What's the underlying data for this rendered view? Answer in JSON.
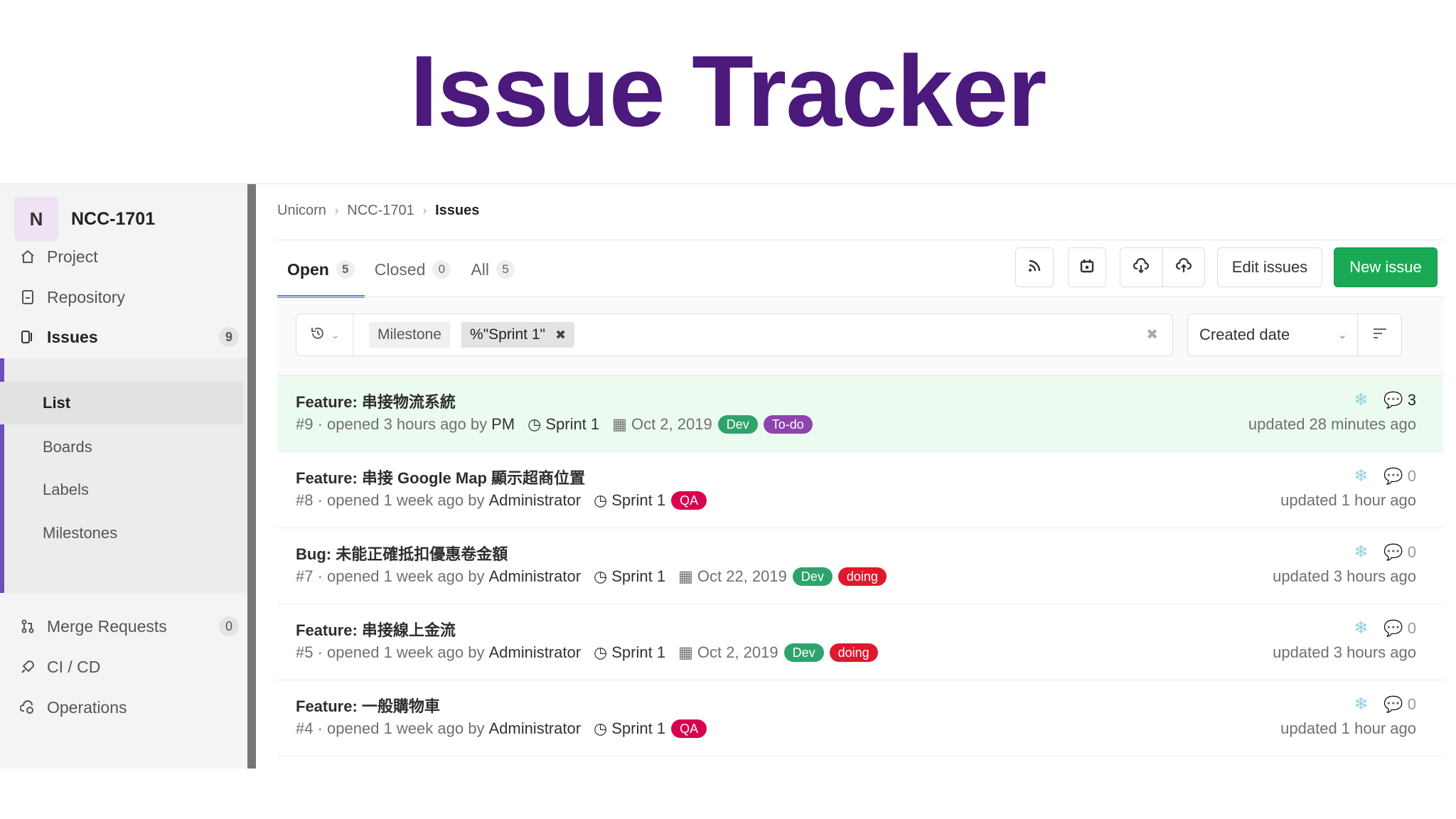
{
  "slide_title": "Issue Tracker",
  "project": {
    "avatar_letter": "N",
    "name": "NCC-1701"
  },
  "sidebar": {
    "items": [
      {
        "label": "Project",
        "icon": "home-icon"
      },
      {
        "label": "Repository",
        "icon": "document-icon"
      },
      {
        "label": "Issues",
        "icon": "issues-icon",
        "count": "9"
      },
      {
        "label": "Merge Requests",
        "icon": "merge-request-icon",
        "count": "0"
      },
      {
        "label": "CI / CD",
        "icon": "rocket-icon"
      },
      {
        "label": "Operations",
        "icon": "cloud-gear-icon"
      }
    ],
    "issues_sub": [
      "List",
      "Boards",
      "Labels",
      "Milestones"
    ]
  },
  "breadcrumb": [
    "Unicorn",
    "NCC-1701",
    "Issues"
  ],
  "tabs": [
    {
      "label": "Open",
      "count": "5"
    },
    {
      "label": "Closed",
      "count": "0"
    },
    {
      "label": "All",
      "count": "5"
    }
  ],
  "toolbar": {
    "edit_label": "Edit issues",
    "new_label": "New issue"
  },
  "filter": {
    "token_name": "Milestone",
    "token_value": "%\"Sprint 1\""
  },
  "sort": {
    "label": "Created date"
  },
  "colors": {
    "accent": "#6b4fbb",
    "new_button": "#1aaa55",
    "label_dev": "#2fa36b",
    "label_todo": "#8e44ad",
    "label_qa": "#d8004e",
    "label_doing": "#e0182d"
  },
  "issues": [
    {
      "title": "Feature: 串接物流系統",
      "ref": "#9",
      "opened": "· opened 3 hours ago by",
      "author": "PM",
      "milestone": "Sprint 1",
      "due": "Oct 2, 2019",
      "labels": [
        "Dev",
        "To-do"
      ],
      "comments": "3",
      "updated": "updated 28 minutes ago"
    },
    {
      "title": "Feature: 串接 Google Map 顯示超商位置",
      "ref": "#8",
      "opened": "· opened 1 week ago by",
      "author": "Administrator",
      "milestone": "Sprint 1",
      "due": "",
      "labels": [
        "QA"
      ],
      "comments": "0",
      "updated": "updated 1 hour ago"
    },
    {
      "title": "Bug: 未能正確抵扣優惠卷金額",
      "ref": "#7",
      "opened": "· opened 1 week ago by",
      "author": "Administrator",
      "milestone": "Sprint 1",
      "due": "Oct 22, 2019",
      "labels": [
        "Dev",
        "doing"
      ],
      "comments": "0",
      "updated": "updated 3 hours ago"
    },
    {
      "title": "Feature: 串接線上金流",
      "ref": "#5",
      "opened": "· opened 1 week ago by",
      "author": "Administrator",
      "milestone": "Sprint 1",
      "due": "Oct 2, 2019",
      "labels": [
        "Dev",
        "doing"
      ],
      "comments": "0",
      "updated": "updated 3 hours ago"
    },
    {
      "title": "Feature: 一般購物車",
      "ref": "#4",
      "opened": "· opened 1 week ago by",
      "author": "Administrator",
      "milestone": "Sprint 1",
      "due": "",
      "labels": [
        "QA"
      ],
      "comments": "0",
      "updated": "updated 1 hour ago"
    }
  ]
}
